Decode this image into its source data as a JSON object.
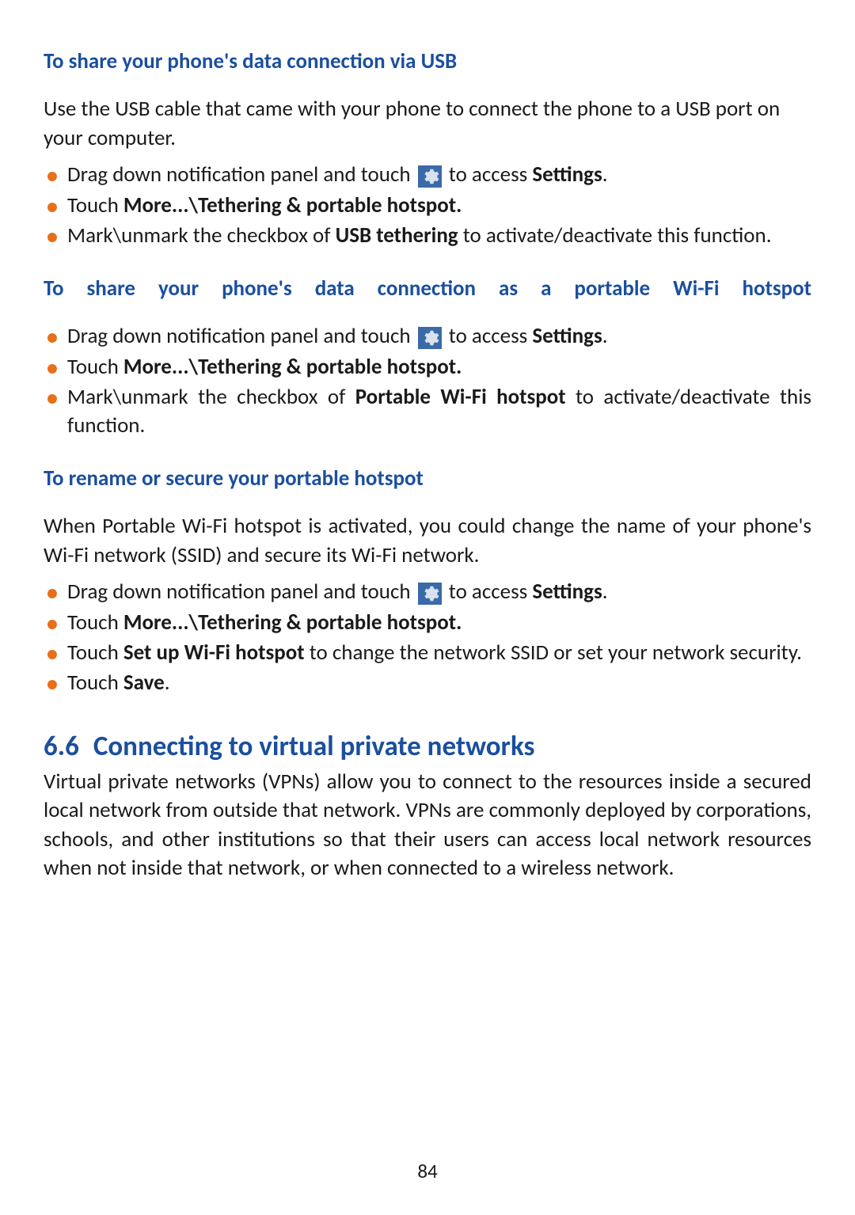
{
  "section1": {
    "heading": "To share your phone's data connection via USB",
    "para": "Use the USB cable that came with your phone to connect the phone to a USB port on your computer.",
    "bullets": [
      {
        "pre": "Drag down notification panel and touch ",
        "icon": true,
        "post": " to access ",
        "bold_tail": "Settings",
        "tail": "."
      },
      {
        "pre": "Touch ",
        "bold": "More...\\Tethering & portable hotspot."
      },
      {
        "pre": "Mark\\unmark the checkbox of ",
        "bold": "USB tethering",
        "post": " to activate/deactivate this function.",
        "justify": true
      }
    ]
  },
  "section2": {
    "heading": "To share your phone's data connection as a portable Wi-Fi hotspot",
    "bullets": [
      {
        "pre": "Drag down notification panel and touch ",
        "icon": true,
        "post": " to access ",
        "bold_tail": "Settings",
        "tail": "."
      },
      {
        "pre": "Touch ",
        "bold": "More...\\Tethering & portable hotspot."
      },
      {
        "pre": "Mark\\unmark the checkbox of ",
        "bold": "Portable Wi-Fi hotspot",
        "post": " to activate/deactivate this function.",
        "justify": true
      }
    ]
  },
  "section3": {
    "heading": "To rename or secure your portable hotspot",
    "para": "When Portable Wi-Fi hotspot is activated, you could change the name of your phone's Wi-Fi network (SSID) and secure its Wi-Fi network.",
    "bullets": [
      {
        "pre": "Drag down notification panel and touch ",
        "icon": true,
        "post": " to access ",
        "bold_tail": "Settings",
        "tail": "."
      },
      {
        "pre": "Touch ",
        "bold": "More...\\Tethering & portable hotspot."
      },
      {
        "pre": "Touch ",
        "bold": "Set up Wi-Fi hotspot",
        "post": " to change the network SSID or set your network security."
      },
      {
        "pre": "Touch ",
        "bold": "Save",
        "post": "."
      }
    ]
  },
  "section4": {
    "number": "6.6",
    "title": "Connecting to virtual private networks",
    "para": "Virtual private networks (VPNs) allow you to connect to the resources inside a secured local network from outside that network. VPNs are commonly deployed by corporations, schools, and other institutions so that their users can access local network resources when not inside that network, or when connected to a wireless network."
  },
  "page_number": "84"
}
